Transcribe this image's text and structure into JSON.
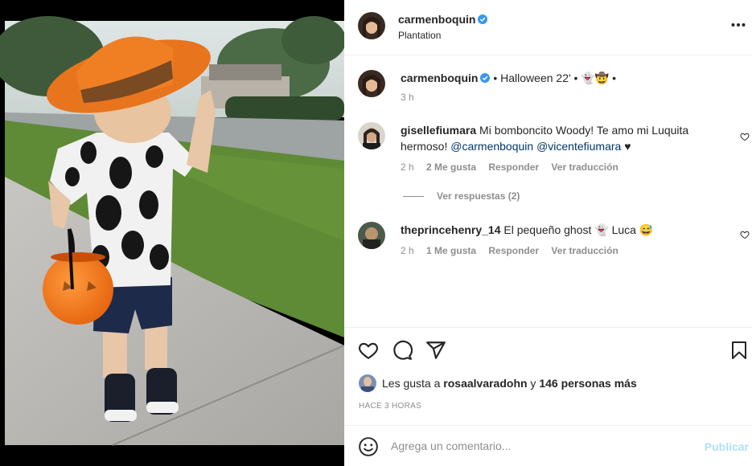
{
  "post": {
    "author": "carmenboquin",
    "location": "Plantation",
    "more_icon": "more-icon",
    "caption": {
      "author": "carmenboquin",
      "text": " • Halloween 22' • 👻🤠 •",
      "time": "3 h"
    }
  },
  "comments": [
    {
      "author": "gisellefiumara",
      "text_before": " Mi bomboncito Woody! Te amo mi Luquita hermoso! ",
      "mention1": "@carmenboquin",
      "mention2": "@vicentefiumara",
      "text_after": " ♥",
      "time": "2 h",
      "likes": "2 Me gusta",
      "reply": "Responder",
      "translate": "Ver traducción",
      "view_replies": "Ver respuestas (2)"
    },
    {
      "author": "theprincehenry_14",
      "text": " El pequeño ghost 👻 Luca 😅",
      "time": "2 h",
      "likes": "1 Me gusta",
      "reply": "Responder",
      "translate": "Ver traducción"
    }
  ],
  "actions": {
    "likes_prefix": "Les gusta a ",
    "liked_by": "rosaalvaradohn",
    "likes_mid": " y ",
    "likes_count": "146 personas más",
    "posted_ago": "HACE 3 HORAS"
  },
  "composer": {
    "placeholder": "Agrega un comentario...",
    "publish": "Publicar"
  },
  "colors": {
    "verified": "#3897f0",
    "link": "#00376b",
    "muted": "#8e8e8e",
    "publish_disabled": "#b2dffc"
  }
}
